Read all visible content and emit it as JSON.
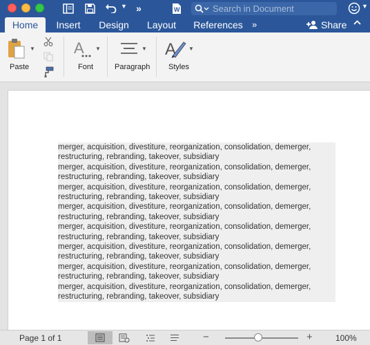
{
  "titlebar": {
    "search_placeholder": "Search in Document"
  },
  "tabs": [
    {
      "label": "Home",
      "active": true
    },
    {
      "label": "Insert"
    },
    {
      "label": "Design"
    },
    {
      "label": "Layout"
    },
    {
      "label": "References"
    }
  ],
  "share_label": "Share",
  "ribbon": {
    "paste": "Paste",
    "font": "Font",
    "paragraph": "Paragraph",
    "styles": "Styles"
  },
  "document": {
    "paragraphs": [
      "merger, acquisition, divestiture, reorganization, consolidation, demerger, restructuring, rebranding, takeover, subsidiary",
      "merger, acquisition, divestiture, reorganization, consolidation, demerger, restructuring, rebranding, takeover, subsidiary",
      "merger, acquisition, divestiture, reorganization, consolidation, demerger, restructuring, rebranding, takeover, subsidiary",
      "merger, acquisition, divestiture, reorganization, consolidation, demerger, restructuring, rebranding, takeover, subsidiary",
      "merger, acquisition, divestiture, reorganization, consolidation, demerger, restructuring, rebranding, takeover, subsidiary",
      "merger, acquisition, divestiture, reorganization, consolidation, demerger, restructuring, rebranding, takeover, subsidiary",
      "merger, acquisition, divestiture, reorganization, consolidation, demerger, restructuring, rebranding, takeover, subsidiary",
      "merger, acquisition, divestiture, reorganization, consolidation, demerger, restructuring, rebranding, takeover, subsidiary"
    ]
  },
  "statusbar": {
    "page_info": "Page 1 of 1",
    "zoom_level": "100%",
    "zoom_fraction": 0.45
  },
  "colors": {
    "accent": "#2b579a"
  }
}
